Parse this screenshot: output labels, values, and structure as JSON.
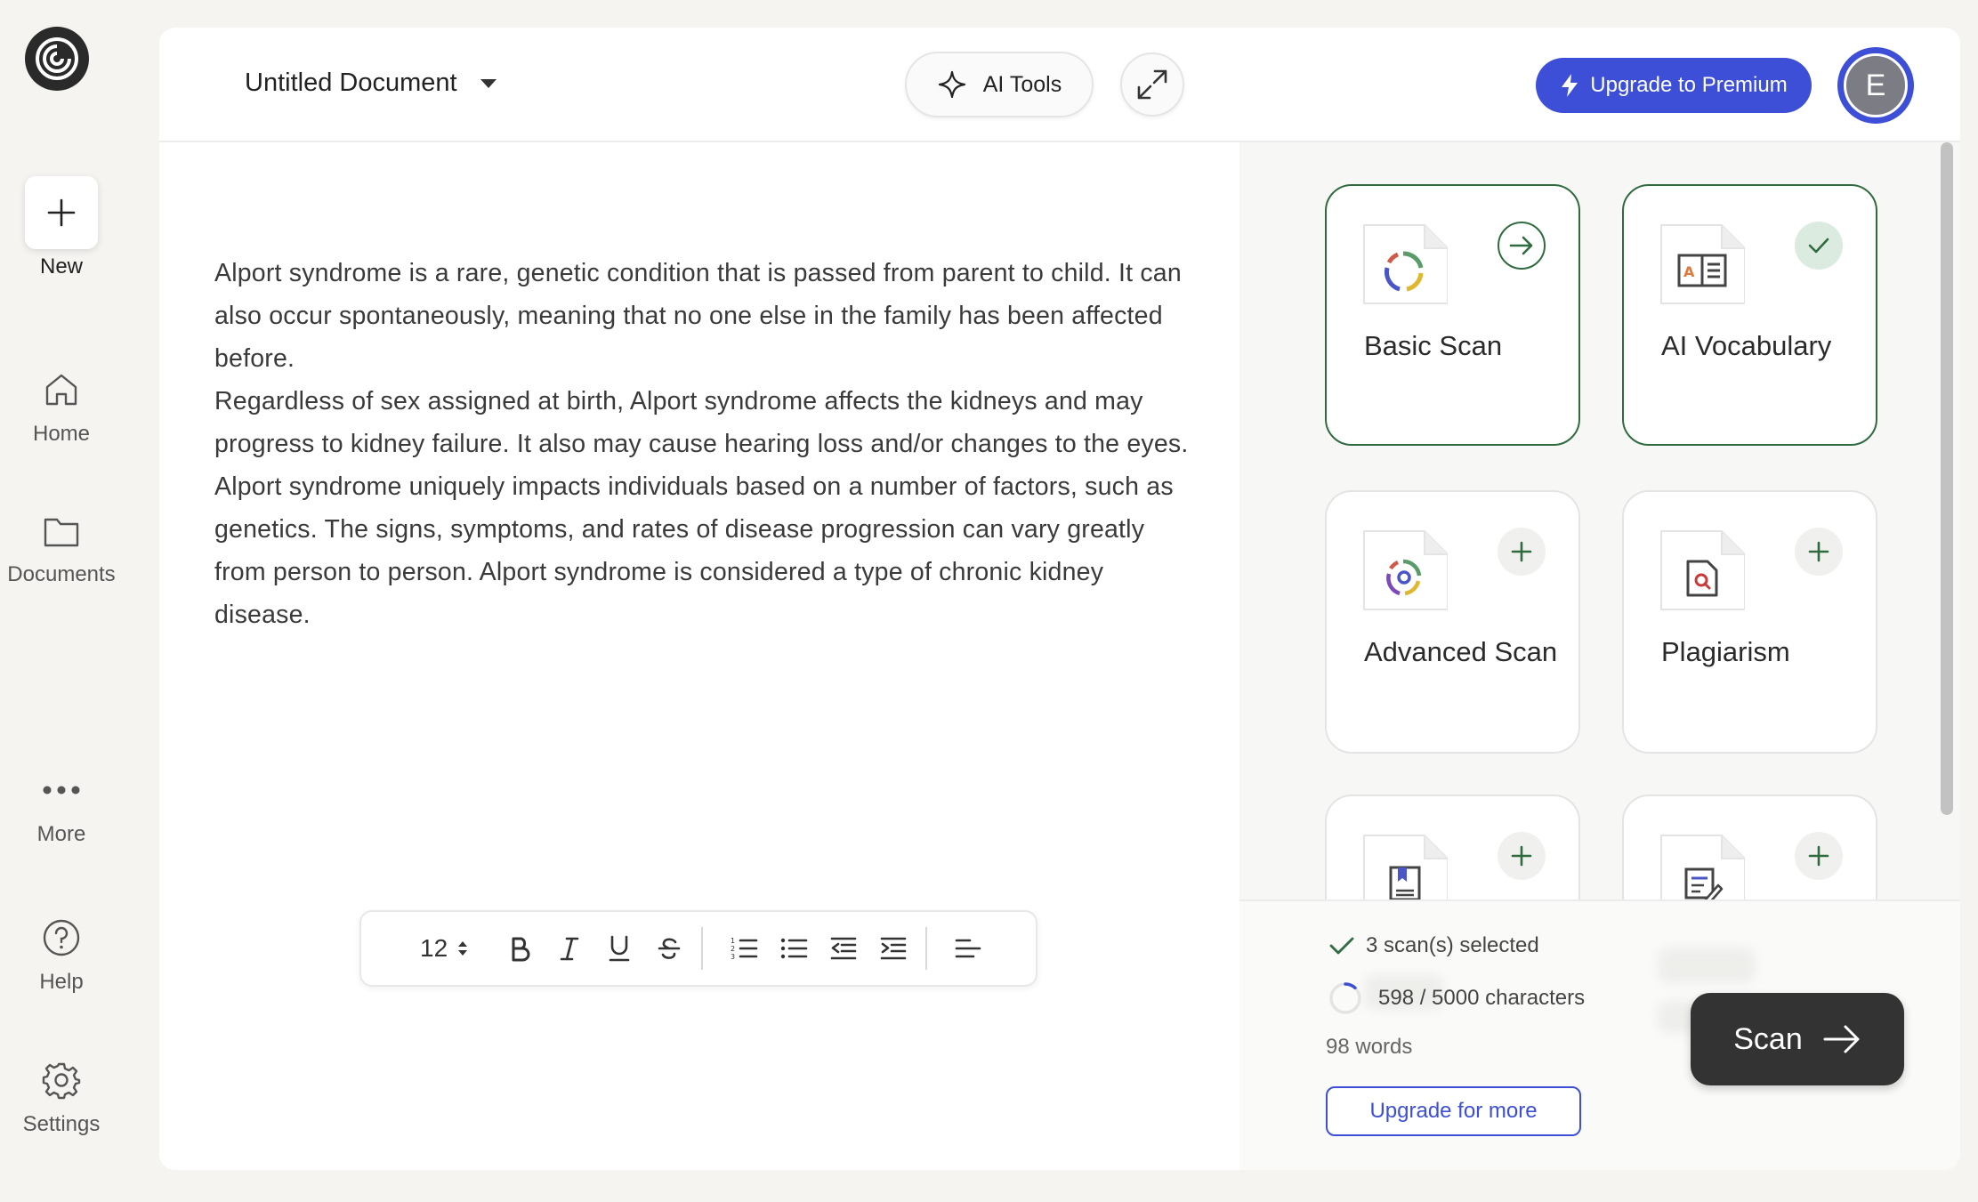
{
  "sidebar": {
    "new_label": "New",
    "items": [
      {
        "label": "Home",
        "icon": "home-icon"
      },
      {
        "label": "Documents",
        "icon": "folder-icon"
      },
      {
        "label": "More",
        "icon": "more-icon"
      },
      {
        "label": "Help",
        "icon": "help-icon"
      },
      {
        "label": "Settings",
        "icon": "gear-icon"
      }
    ]
  },
  "editor": {
    "doc_title": "Untitled Document",
    "ai_tools_label": "AI Tools",
    "paragraphs": [
      "Alport syndrome is a rare, genetic condition that is passed from parent to child. It can also occur spontaneously, meaning that no one else in the family has been affected before.",
      "Regardless of sex assigned at birth, Alport syndrome affects the kidneys and may progress to kidney failure. It also may cause hearing loss and/or changes to the eyes.",
      "Alport syndrome uniquely impacts individuals based on a number of factors, such as genetics. The signs, symptoms, and rates of disease progression can vary greatly from person to person. Alport syndrome is considered a type of chronic kidney disease."
    ],
    "toolbar": {
      "font_size": "12",
      "buttons": [
        "bold-icon",
        "italic-icon",
        "underline-icon",
        "strikethrough-icon",
        "ordered-list-icon",
        "bullet-list-icon",
        "outdent-icon",
        "indent-icon",
        "align-left-icon"
      ]
    }
  },
  "panel": {
    "premium_label": "Upgrade to Premium",
    "avatar_initial": "E",
    "cards": [
      {
        "title": "Basic Scan",
        "state": "selected",
        "badge": "arrow"
      },
      {
        "title": "AI Vocabulary",
        "state": "selected",
        "badge": "check"
      },
      {
        "title": "Advanced Scan",
        "state": "available",
        "badge": "plus"
      },
      {
        "title": "Plagiarism",
        "state": "available",
        "badge": "plus"
      },
      {
        "title": "",
        "state": "available",
        "badge": "plus"
      },
      {
        "title": "",
        "state": "available",
        "badge": "plus"
      }
    ],
    "footer": {
      "selected_text": "3 scan(s) selected",
      "chars_text": "598 / 5000 characters",
      "chars_used": 598,
      "chars_limit": 5000,
      "words_text": "98 words",
      "upgrade_more_label": "Upgrade for more",
      "scan_label": "Scan"
    }
  },
  "colors": {
    "accent": "#3d4fd6",
    "selected_border": "#2f6b3f",
    "dark_button": "#333333"
  }
}
